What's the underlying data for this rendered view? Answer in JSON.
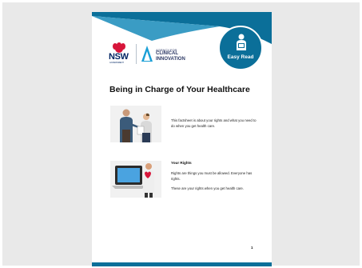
{
  "viewer": {
    "background_color": "#e9e9e9"
  },
  "document": {
    "brand_color": "#0b6f99",
    "badge": {
      "icon": "person-reading-icon",
      "label": "Easy Read"
    },
    "logos": {
      "nsw": {
        "wordmark": "NSW",
        "sub": "GOVERNMENT"
      },
      "agency": {
        "line1": "AGENCY FOR",
        "line2": "CLINICAL",
        "line3": "INNOVATION"
      }
    },
    "title": "Being in Charge of Your Healthcare",
    "sections": [
      {
        "image": "doctor-and-patient-illustration",
        "paragraphs": [
          "This factsheet is about your rights and what you need to do when you get health care."
        ]
      },
      {
        "heading": "Your Rights",
        "image": "person-with-laptop-and-heart-illustration",
        "paragraphs": [
          "Rights are things you must be allowed. Everyone has rights.",
          "These are your rights when you get health care."
        ]
      }
    ],
    "page_number": "1"
  }
}
